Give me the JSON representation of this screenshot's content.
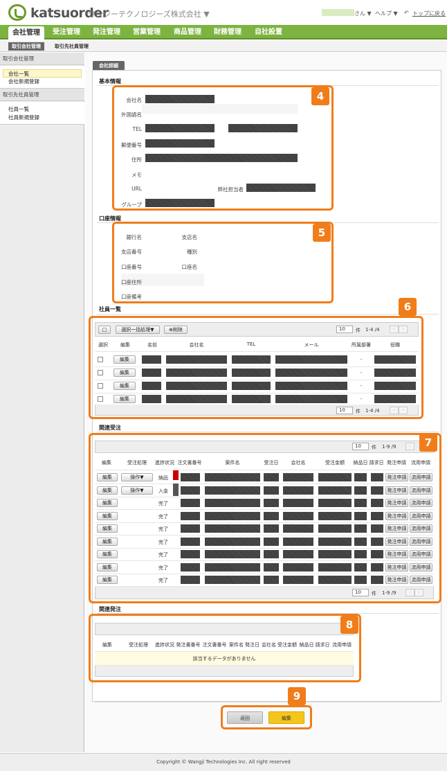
{
  "header": {
    "logo_text": "katsuorder",
    "company": "ワンジーテクノロジーズ株式会社 ▼",
    "user_suffix": "さん ▼",
    "help": "ヘルプ ▼",
    "back_top": "トップに戻る"
  },
  "mainnav": [
    "会社管理",
    "受注管理",
    "発注管理",
    "営業管理",
    "商品管理",
    "財務管理",
    "自社設置"
  ],
  "subnav": [
    "取引会社管理",
    "取引先社員管理"
  ],
  "sidebar": {
    "group1_title": "取引会社管理",
    "group1_items": [
      "会社一覧",
      "会社新規登録"
    ],
    "group2_title": "取引先社員管理",
    "group2_items": [
      "社員一覧",
      "社員新規登録"
    ]
  },
  "content_tab": "会社詳細",
  "basic": {
    "title": "基本情報",
    "labels": {
      "company": "会社名",
      "foreign": "外国語名",
      "tel": "TEL",
      "zip": "郵便番号",
      "address": "住所",
      "memo": "メモ",
      "url": "URL",
      "manager": "弊社担当者",
      "group": "グループ"
    }
  },
  "bank": {
    "title": "口座情報",
    "labels": {
      "bank": "銀行名",
      "branch": "支店名",
      "branch_no": "支店番号",
      "type": "種別",
      "acct_no": "口座番号",
      "acct_name": "口座名",
      "acct_addr": "口座住所",
      "acct_note": "口座備考"
    }
  },
  "staff": {
    "title": "社員一覧",
    "toolbar": {
      "select_all": "□",
      "bulk": "選択一括処理▼",
      "delete": "⊗削除"
    },
    "pager": {
      "per_page": "10",
      "unit": "件",
      "range": "1-4 /4"
    },
    "columns": [
      "選択",
      "編集",
      "名前",
      "会社名",
      "TEL",
      "メール",
      "所属部署",
      "役職"
    ],
    "row_edit": "編集",
    "dept_placeholder": "-",
    "rows": 4
  },
  "orders": {
    "title": "関連受注",
    "pager": {
      "per_page": "10",
      "unit": "件",
      "range": "1-9 /9"
    },
    "columns": [
      "編集",
      "受注処理",
      "進捗状況",
      "注文書番号",
      "案件名",
      "受注日",
      "会社名",
      "受注金額",
      "納品日",
      "請求日",
      "発注申請",
      "流用申請"
    ],
    "row_edit": "編集",
    "action_btn": "操作▼",
    "order_req": "発注申請",
    "reuse_req": "流用申請",
    "statuses": [
      "納品",
      "入金",
      "完了",
      "完了",
      "完了",
      "完了",
      "完了",
      "完了",
      "完了"
    ]
  },
  "orders2": {
    "title": "関連発注",
    "columns": [
      "編集",
      "受注処理",
      "進捗状況",
      "発注書番号",
      "注文書番号",
      "案件名",
      "発注日",
      "会社名",
      "受注金額",
      "納品日",
      "請求日",
      "流用申請"
    ],
    "empty": "該当するデータがありません"
  },
  "buttons": {
    "back": "返回",
    "edit": "編集"
  },
  "badges": [
    "4",
    "5",
    "6",
    "7",
    "8",
    "9"
  ],
  "footer": "Copyright © Wangji Technologies Inc. All right reserved",
  "colors": {
    "accent": "#f07d1a",
    "nav": "#7db341",
    "edit_button": "#f6c51b"
  }
}
